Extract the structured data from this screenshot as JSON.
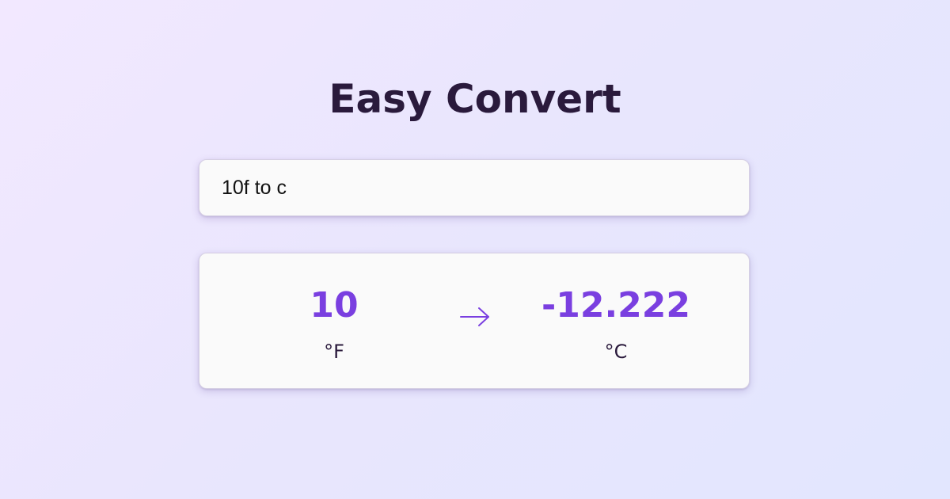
{
  "app": {
    "title": "Easy Convert"
  },
  "search": {
    "value": "10f to c"
  },
  "result": {
    "from_value": "10",
    "from_unit": "°F",
    "to_value": "-12.222",
    "to_unit": "°C",
    "arrow_icon": "arrow-right-icon"
  },
  "colors": {
    "accent": "#7a3fe0",
    "title": "#2a1a3c",
    "card_background": "#fafafa"
  }
}
